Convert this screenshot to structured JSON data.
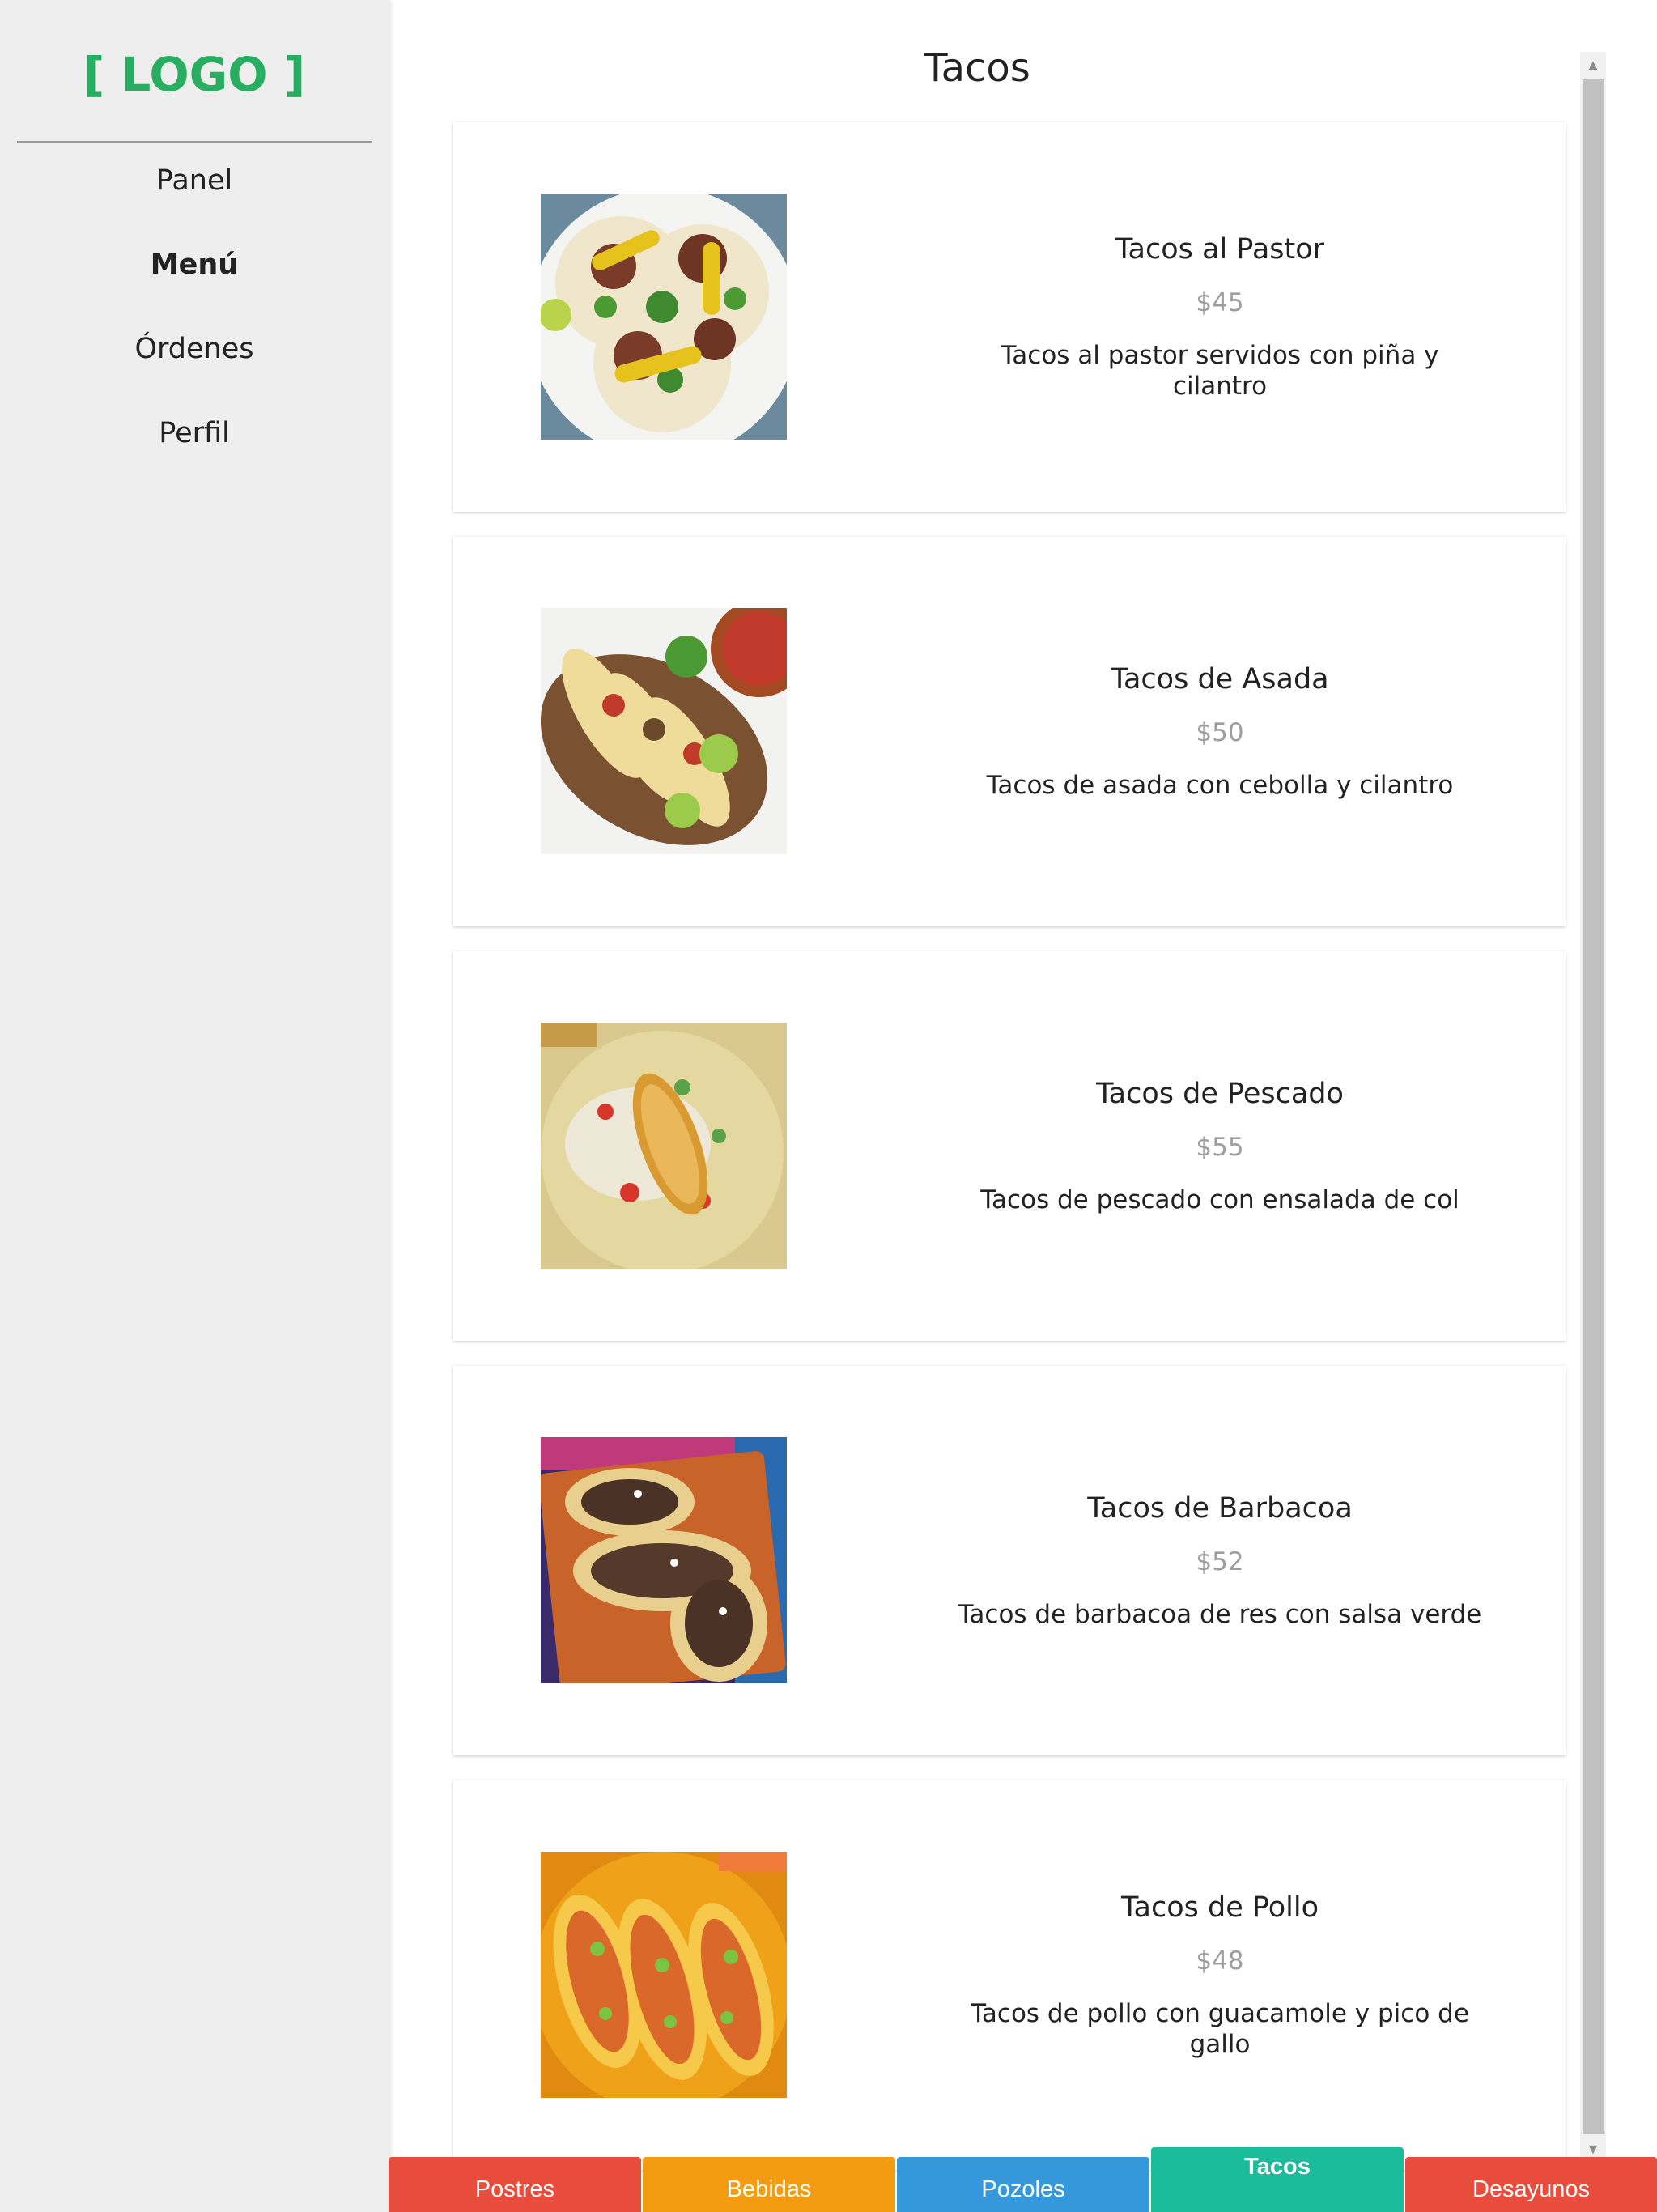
{
  "sidebar": {
    "logo": "[ LOGO ]",
    "items": [
      {
        "label": "Panel",
        "active": false
      },
      {
        "label": "Menú",
        "active": true
      },
      {
        "label": "Órdenes",
        "active": false
      },
      {
        "label": "Perfil",
        "active": false
      }
    ]
  },
  "main": {
    "title": "Tacos",
    "items": [
      {
        "name": "Tacos al Pastor",
        "price": "$45",
        "description": "Tacos al pastor servidos con piña y cilantro",
        "image": "tacos-al-pastor-photo"
      },
      {
        "name": "Tacos de Asada",
        "price": "$50",
        "description": "Tacos de asada con cebolla y cilantro",
        "image": "tacos-de-asada-photo"
      },
      {
        "name": "Tacos de Pescado",
        "price": "$55",
        "description": "Tacos de pescado con ensalada de col",
        "image": "tacos-de-pescado-photo"
      },
      {
        "name": "Tacos de Barbacoa",
        "price": "$52",
        "description": "Tacos de barbacoa de res con salsa verde",
        "image": "tacos-de-barbacoa-photo"
      },
      {
        "name": "Tacos de Pollo",
        "price": "$48",
        "description": "Tacos de pollo con guacamole y pico de gallo",
        "image": "tacos-de-pollo-photo"
      }
    ]
  },
  "tabs": [
    {
      "label": "Postres",
      "color": "#e74c3c",
      "active": false
    },
    {
      "label": "Bebidas",
      "color": "#f39c12",
      "active": false
    },
    {
      "label": "Pozoles",
      "color": "#3498db",
      "active": false
    },
    {
      "label": "Tacos",
      "color": "#1abc9c",
      "active": true
    },
    {
      "label": "Desayunos",
      "color": "#e74c3c",
      "active": false
    }
  ],
  "colors": {
    "logo": "#27ae60",
    "sidebar_bg": "#eeeeee",
    "price": "#9e9e9e"
  }
}
